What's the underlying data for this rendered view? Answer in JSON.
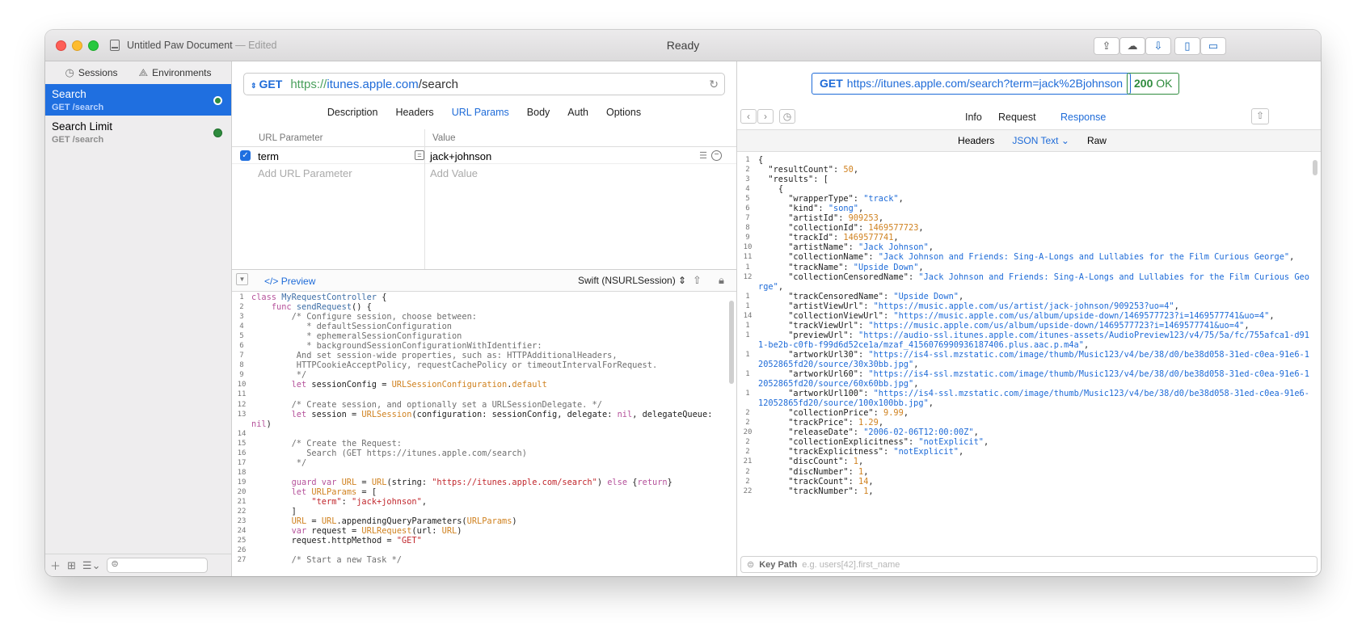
{
  "window": {
    "title": "Untitled Paw Document",
    "edited": " — Edited",
    "status": "Ready"
  },
  "sidebar": {
    "tabs": [
      {
        "label": "Sessions",
        "icon": "clock-icon"
      },
      {
        "label": "Environments",
        "icon": "environment-icon"
      }
    ],
    "requests": [
      {
        "name": "Search",
        "path": "GET /search",
        "status_color": "#2e8b3d"
      },
      {
        "name": "Search Limit",
        "path": "GET /search",
        "status_color": "#2e8b3d"
      }
    ]
  },
  "request": {
    "method": "GET",
    "url_scheme": "https://",
    "url_host": "itunes.apple.com",
    "url_path": "/search",
    "tabs": [
      "Description",
      "Headers",
      "URL Params",
      "Body",
      "Auth",
      "Options"
    ],
    "active_tab": "URL Params",
    "params_header": {
      "name": "URL Parameter",
      "value": "Value"
    },
    "params": [
      {
        "name": "term",
        "value": "jack+johnson"
      }
    ],
    "add_name_placeholder": "Add URL Parameter",
    "add_value_placeholder": "Add Value"
  },
  "codegen": {
    "preview_label": "Preview",
    "language": "Swift (NSURLSession)"
  },
  "response": {
    "method": "GET",
    "url": "https://itunes.apple.com/search?term=jack%2Bjohnson",
    "status_code": "200",
    "status_text": "OK",
    "tabs": [
      "Info",
      "Request",
      "Response"
    ],
    "active_tab": "Response",
    "subtabs": [
      "Headers",
      "JSON Text",
      "Raw"
    ],
    "active_subtab": "JSON Text",
    "keypath_label": "Key Path",
    "keypath_placeholder": "e.g. users[42].first_name"
  },
  "colors": {
    "accent": "#1e6bd8",
    "selection": "#1f6fe0",
    "success": "#2e8b3d"
  }
}
